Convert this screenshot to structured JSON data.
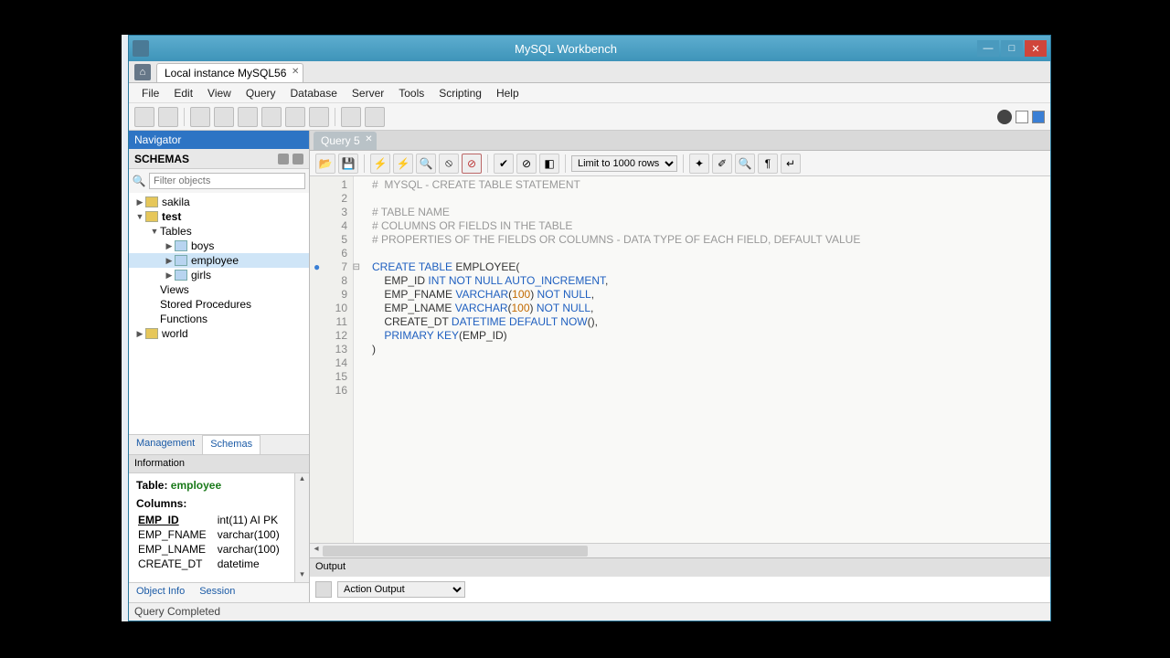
{
  "window": {
    "title": "MySQL Workbench",
    "tab": "Local instance MySQL56"
  },
  "menubar": [
    "File",
    "Edit",
    "View",
    "Query",
    "Database",
    "Server",
    "Tools",
    "Scripting",
    "Help"
  ],
  "navigator": {
    "title": "Navigator",
    "section": "SCHEMAS",
    "filter_placeholder": "Filter objects",
    "tree": {
      "sakila": "sakila",
      "test": "test",
      "tables": "Tables",
      "boys": "boys",
      "employee": "employee",
      "girls": "girls",
      "views": "Views",
      "sprocs": "Stored Procedures",
      "functions": "Functions",
      "world": "world"
    },
    "bottom_tabs": {
      "management": "Management",
      "schemas": "Schemas"
    },
    "info_header": "Information",
    "info": {
      "table_label": "Table:",
      "table_name": "employee",
      "columns_label": "Columns:",
      "cols": [
        {
          "name": "EMP_ID",
          "type": "int(11) AI PK"
        },
        {
          "name": "EMP_FNAME",
          "type": "varchar(100)"
        },
        {
          "name": "EMP_LNAME",
          "type": "varchar(100)"
        },
        {
          "name": "CREATE_DT",
          "type": "datetime"
        }
      ]
    },
    "obj_tabs": {
      "objinfo": "Object Info",
      "session": "Session"
    }
  },
  "editor": {
    "query_tab": "Query 5",
    "limit": "Limit to 1000 rows",
    "lines": [
      "#  MYSQL - CREATE TABLE STATEMENT",
      "",
      "# TABLE NAME",
      "# COLUMNS OR FIELDS IN THE TABLE",
      "# PROPERTIES OF THE FIELDS OR COLUMNS - DATA TYPE OF EACH FIELD, DEFAULT VALUE",
      "",
      "CREATE TABLE EMPLOYEE(",
      "    EMP_ID INT NOT NULL AUTO_INCREMENT,",
      "    EMP_FNAME VARCHAR(100) NOT NULL,",
      "    EMP_LNAME VARCHAR(100) NOT NULL,",
      "    CREATE_DT DATETIME DEFAULT NOW(),",
      "    PRIMARY KEY(EMP_ID)",
      ")",
      "",
      "",
      ""
    ]
  },
  "output": {
    "header": "Output",
    "mode": "Action Output"
  },
  "status": "Query Completed"
}
